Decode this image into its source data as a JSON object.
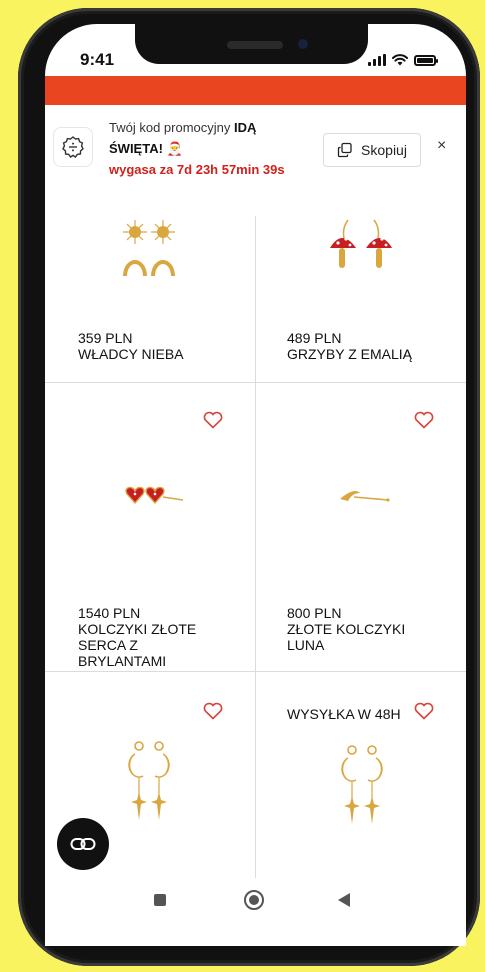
{
  "status": {
    "time": "9:41"
  },
  "promo": {
    "line1_prefix": "Twój kod promocyjny",
    "code_part1": "IDĄ",
    "code_part2": "ŚWIĘTA!",
    "gift_emoji": "🎅",
    "expires": "wygasa za 7d 23h 57min 39s",
    "copy_label": "Skopiuj",
    "close_label": "×"
  },
  "products": [
    {
      "price": "359 PLN",
      "name": "WŁADCY NIEBA",
      "badge": ""
    },
    {
      "price": "489 PLN",
      "name": "GRZYBY Z EMALIĄ",
      "badge": ""
    },
    {
      "price": "1540 PLN",
      "name_lines": [
        "KOLCZYKI ZŁOTE",
        "SERCA Z",
        "BRYLANTAMI"
      ],
      "badge": ""
    },
    {
      "price": "800 PLN",
      "name_lines": [
        "ZŁOTE KOLCZYKI",
        "LUNA"
      ],
      "badge": ""
    },
    {
      "price": "",
      "name": "",
      "badge": ""
    },
    {
      "price": "",
      "name": "",
      "badge": "WYSYŁKA W 48H"
    }
  ],
  "colors": {
    "accent": "#ea4521",
    "heart": "#d6453b",
    "gold": "#d9a640",
    "background": "#f8f35e"
  },
  "icons": {
    "promo": "discount-badge-icon",
    "copy": "copy-icon",
    "heart": "heart-outline-icon",
    "fab": "link-icon",
    "nav_home": "square-icon",
    "nav_center": "circle-icon",
    "nav_back": "triangle-back-icon"
  }
}
